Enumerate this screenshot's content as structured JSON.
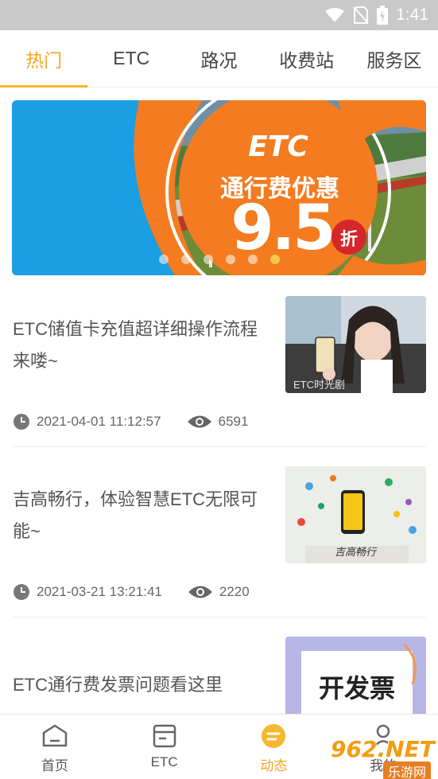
{
  "status_bar": {
    "time": "1:41"
  },
  "tabs": [
    {
      "label": "热门"
    },
    {
      "label": "ETC"
    },
    {
      "label": "路况"
    },
    {
      "label": "收费站"
    },
    {
      "label": "服务区"
    }
  ],
  "banner": {
    "logo_text": "ETC",
    "headline": "通行费优惠",
    "discount_value": "9.5",
    "discount_unit": "折",
    "slide_count": 6,
    "active_slide": 6
  },
  "news": [
    {
      "title": "ETC储值卡充值超详细操作流程来喽~",
      "date": "2021-04-01 11:12:57",
      "views": "6591",
      "thumb_caption": "ETC时光剧"
    },
    {
      "title": "吉高畅行，体验智慧ETC无限可能~",
      "date": "2021-03-21 13:21:41",
      "views": "2220",
      "thumb_caption": "吉高畅行"
    },
    {
      "title": "ETC通行费发票问题看这里",
      "thumb_caption": "开发票"
    }
  ],
  "bottom_nav": [
    {
      "label": "首页",
      "icon": "home-icon"
    },
    {
      "label": "ETC",
      "icon": "card-icon"
    },
    {
      "label": "动态",
      "icon": "news-icon"
    },
    {
      "label": "我的",
      "icon": "user-icon"
    }
  ],
  "watermark": {
    "text": "962.NET",
    "subtext": "乐游网"
  },
  "colors": {
    "accent": "#f5a623",
    "banner_blue": "#1b9ee3",
    "banner_orange": "#f47b20"
  }
}
